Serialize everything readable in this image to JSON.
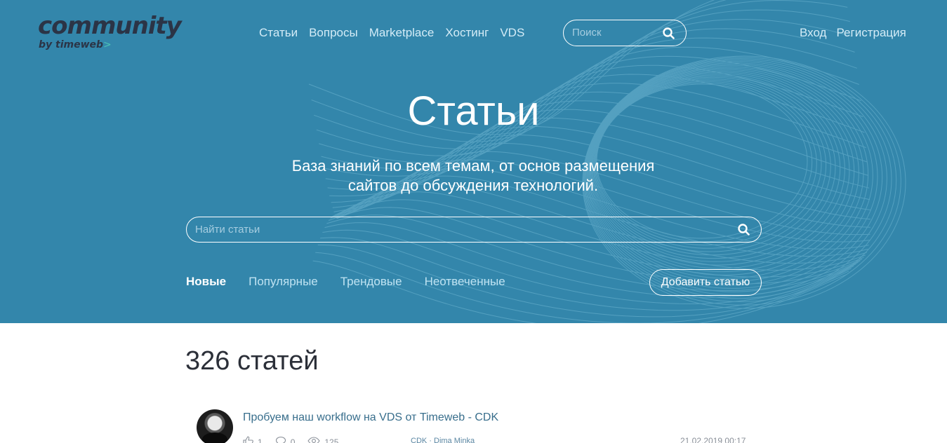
{
  "logo": {
    "main": "community",
    "sub": "by timeweb",
    "sub_arrow": ">"
  },
  "nav": [
    {
      "label": "Статьи"
    },
    {
      "label": "Вопросы"
    },
    {
      "label": "Marketplace"
    },
    {
      "label": "Хостинг"
    },
    {
      "label": "VDS"
    }
  ],
  "top_search": {
    "placeholder": "Поиск",
    "icon": "search-icon"
  },
  "auth": {
    "login": "Вход",
    "register": "Регистрация"
  },
  "hero": {
    "title": "Статьи",
    "subtitle_line1": "База знаний по всем темам, от основ размещения",
    "subtitle_line2": "сайтов до обсуждения технологий."
  },
  "article_search": {
    "placeholder": "Найти статьи",
    "icon": "search-icon"
  },
  "tabs": [
    {
      "label": "Новые",
      "active": true
    },
    {
      "label": "Популярные",
      "active": false
    },
    {
      "label": "Трендовые",
      "active": false
    },
    {
      "label": "Неотвеченные",
      "active": false
    }
  ],
  "add_button": "Добавить статью",
  "count_label": "326 статей",
  "articles": [
    {
      "title": "Пробуем наш workflow на VDS от Timeweb - CDK",
      "likes": "1",
      "comments": "0",
      "views": "125",
      "tags": "CDK · Dima Minka",
      "date": "21.02.2019 00:17"
    }
  ],
  "colors": {
    "hero_bg": "#3386ab",
    "logo": "#2b3446",
    "accent": "#4cc3b5",
    "link": "#386e8c"
  }
}
